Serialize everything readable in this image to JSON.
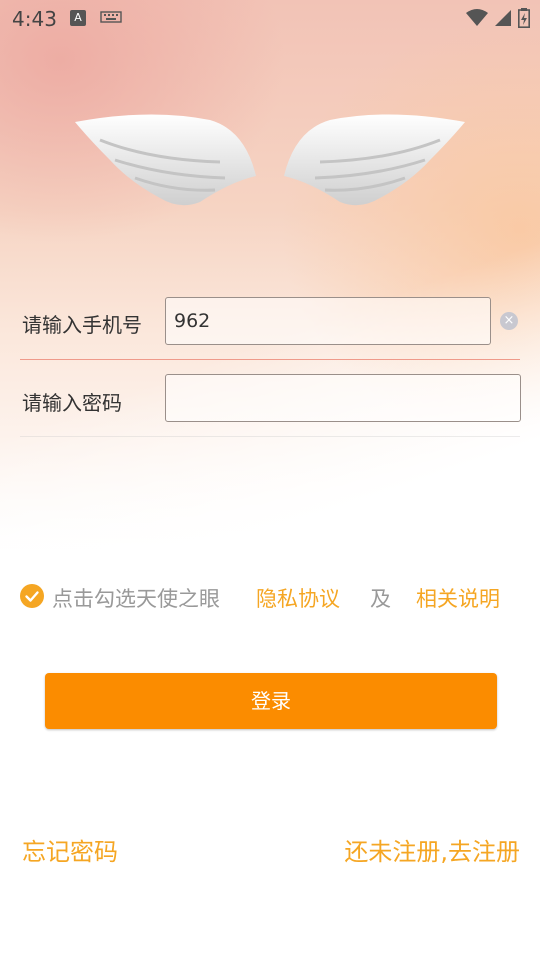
{
  "status_bar": {
    "time": "4:43",
    "notification_letter": "A",
    "icons": [
      "keyboard-icon",
      "wifi-icon",
      "cell-signal-icon",
      "battery-icon"
    ]
  },
  "form": {
    "phone_label": "请输入手机号",
    "phone_value": "962",
    "password_label": "请输入密码",
    "password_value": ""
  },
  "agreement": {
    "checked": true,
    "text": "点击勾选天使之眼",
    "privacy_link": "隐私协议",
    "and_text": "及",
    "terms_link": "相关说明"
  },
  "login_button": "登录",
  "links": {
    "forgot_password": "忘记密码",
    "register": "还未注册,去注册"
  },
  "colors": {
    "accent": "#fb8c00",
    "link": "#f5a623",
    "divider_active": "#ef9a8a"
  }
}
